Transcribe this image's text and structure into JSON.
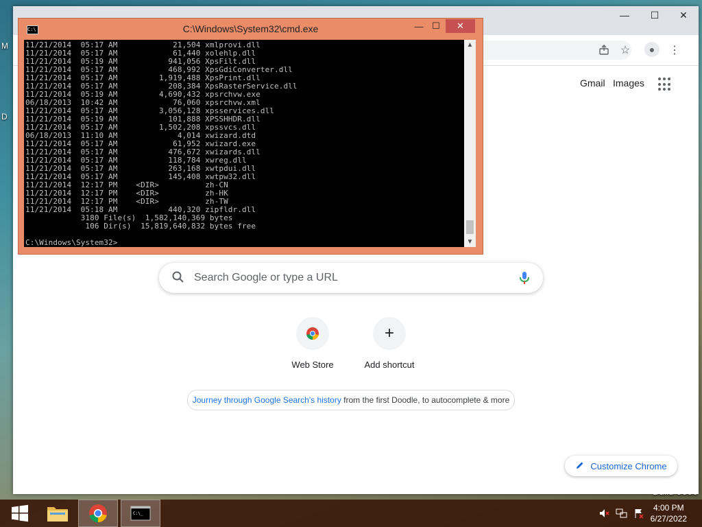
{
  "desktop": {
    "left_fragment_top": "M",
    "left_fragment_mid": "D",
    "build_text": "Build 9600"
  },
  "chrome": {
    "window_controls": {
      "minimize": "—",
      "maximize": "☐",
      "close": "✕"
    },
    "top_links": {
      "gmail": "Gmail",
      "images": "Images"
    },
    "search": {
      "placeholder": "Search Google or type a URL"
    },
    "shortcuts": [
      {
        "label": "Web Store",
        "icon": "chrome-web-store-icon"
      },
      {
        "label": "Add shortcut",
        "icon": "plus-icon"
      }
    ],
    "doodle": {
      "link_text": "Journey through Google Search's history",
      "rest_text": " from the first Doodle, to autocomplete & more"
    },
    "customize_label": "Customize Chrome"
  },
  "cmd": {
    "title": "C:\\Windows\\System32\\cmd.exe",
    "icon_text": "C:\\",
    "output": "11/21/2014  05:17 AM            21,504 xmlprovi.dll\n11/21/2014  05:17 AM            61,440 xolehlp.dll\n11/21/2014  05:19 AM           941,056 XpsFilt.dll\n11/21/2014  05:17 AM           468,992 XpsGdiConverter.dll\n11/21/2014  05:17 AM         1,919,488 XpsPrint.dll\n11/21/2014  05:17 AM           208,384 XpsRasterService.dll\n11/21/2014  05:19 AM         4,690,432 xpsrchvw.exe\n06/18/2013  10:42 AM            76,060 xpsrchvw.xml\n11/21/2014  05:17 AM         3,056,128 xpsservices.dll\n11/21/2014  05:19 AM           101,888 XPSSHHDR.dll\n11/21/2014  05:17 AM         1,502,208 xpssvcs.dll\n06/18/2013  11:10 AM             4,014 xwizard.dtd\n11/21/2014  05:17 AM            61,952 xwizard.exe\n11/21/2014  05:17 AM           476,672 xwizards.dll\n11/21/2014  05:17 AM           118,784 xwreg.dll\n11/21/2014  05:17 AM           263,168 xwtpdui.dll\n11/21/2014  05:17 AM           145,408 xwtpw32.dll\n11/21/2014  12:17 PM    <DIR>          zh-CN\n11/21/2014  12:17 PM    <DIR>          zh-HK\n11/21/2014  12:17 PM    <DIR>          zh-TW\n11/21/2014  05:18 AM           440,320 zipfldr.dll\n            3180 File(s)  1,582,140,369 bytes\n             106 Dir(s)  15,819,640,832 bytes free\n\nC:\\Windows\\System32>",
    "controls": {
      "minimize": "—",
      "maximize": "☐",
      "close": "✕"
    }
  },
  "taskbar": {
    "items": [
      "start-button",
      "file-explorer",
      "google-chrome",
      "command-prompt"
    ],
    "clock_time": "4:00 PM",
    "clock_date": "6/27/2022"
  },
  "colors": {
    "cmd_frame": "#ea8c68",
    "taskbar": "#3c190a",
    "chrome_link": "#1a73e8"
  }
}
